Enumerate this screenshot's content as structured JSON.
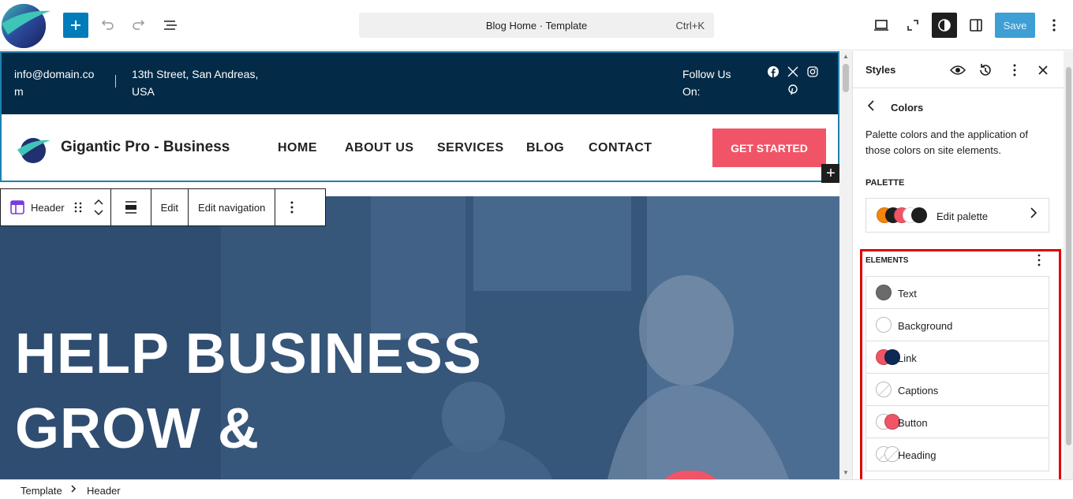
{
  "toolbar": {
    "command_title": "Blog Home · Template",
    "command_shortcut": "Ctrl+K",
    "save_label": "Save"
  },
  "site": {
    "email": "info@domain.com",
    "address": "13th Street, San Andreas, USA",
    "follow": "Follow Us On:",
    "brand": "Gigantic Pro - Business",
    "menu": [
      "HOME",
      "ABOUT US",
      "SERVICES",
      "BLOG",
      "CONTACT"
    ],
    "cta": "GET STARTED",
    "hero_line1": "HELP BUSINESS",
    "hero_line2": "GROW &"
  },
  "block_toolbar": {
    "block_name": "Header",
    "edit": "Edit",
    "edit_navigation": "Edit navigation"
  },
  "sidebar": {
    "title": "Styles",
    "section": "Colors",
    "description": "Palette colors and the application of those colors on site elements.",
    "palette_label": "PALETTE",
    "palette_button": "Edit palette",
    "palette_colors": [
      "#f5850f",
      "#1e1e1e",
      "#f05466",
      "#ffffff",
      "#1e1e1e"
    ],
    "elements_label": "ELEMENTS",
    "elements": [
      {
        "name": "Text",
        "colors": [
          "#6b6b6b"
        ]
      },
      {
        "name": "Background",
        "colors": [
          "#ffffff"
        ]
      },
      {
        "name": "Link",
        "colors": [
          "#f05466",
          "#0c2a55"
        ]
      },
      {
        "name": "Captions",
        "colors": []
      },
      {
        "name": "Button",
        "colors": [
          "#ffffff",
          "#f05466"
        ]
      },
      {
        "name": "Heading",
        "colors": []
      }
    ]
  },
  "breadcrumb": {
    "items": [
      "Template",
      "Header"
    ]
  }
}
